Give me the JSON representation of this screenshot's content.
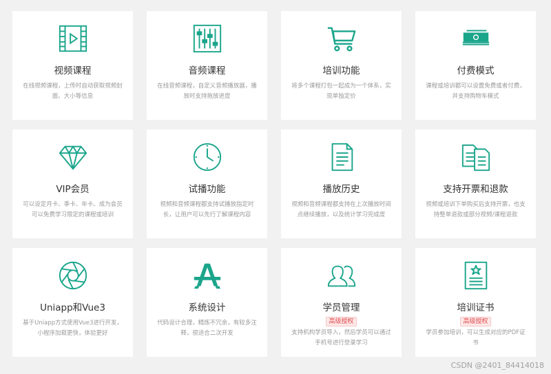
{
  "accent_color": "#1aa58b",
  "features": [
    {
      "icon": "video-film-icon",
      "title": "视频课程",
      "desc": "在线视频课程，上传时自动获取视频封面、大小等信息"
    },
    {
      "icon": "equalizer-icon",
      "title": "音频课程",
      "desc": "在线音频课程，自定义音频播放器，播放时支持拖放进度"
    },
    {
      "icon": "shopping-cart-icon",
      "title": "培训功能",
      "desc": "将多个课程打包一起成为一个体系，实现单独定价"
    },
    {
      "icon": "money-stack-icon",
      "title": "付费模式",
      "desc": "课程或培训都可以设置免费或者付费，并支持购物车模式"
    },
    {
      "icon": "diamond-icon",
      "title": "VIP会员",
      "desc": "可以设定月卡、季卡、年卡、成为会员可以免费学习限定的课程或培训"
    },
    {
      "icon": "clock-icon",
      "title": "试播功能",
      "desc": "视频和音频课程都支持试播放指定时长，让用户可以先行了解课程内容"
    },
    {
      "icon": "document-icon",
      "title": "播放历史",
      "desc": "视频和音频课程都支持在上次播放时间点继续播放，以及统计学习完成度"
    },
    {
      "icon": "copy-documents-icon",
      "title": "支持开票和退款",
      "desc": "视频或培训下单购买后支持开票，也支持整单退款或部分视频/课程退款"
    },
    {
      "icon": "aperture-icon",
      "title": "Uniapp和Vue3",
      "desc": "基于Uniapp方式使用Vue3进行开发，小程序加载更快，体验更好"
    },
    {
      "icon": "app-store-icon",
      "title": "系统设计",
      "desc": "代码设计合理，精炼不冗余，有较多注释，很适合二次开发"
    },
    {
      "icon": "users-icon",
      "title": "学员管理",
      "badge": "高级授权",
      "desc": "支持机构学员导入，然后学员可以通过手机号进行登录学习"
    },
    {
      "icon": "certificate-icon",
      "title": "培训证书",
      "badge": "高级授权",
      "desc": "学员参加培训，可以生成对应的PDF证书"
    }
  ],
  "watermark": "CSDN @2401_84414018"
}
